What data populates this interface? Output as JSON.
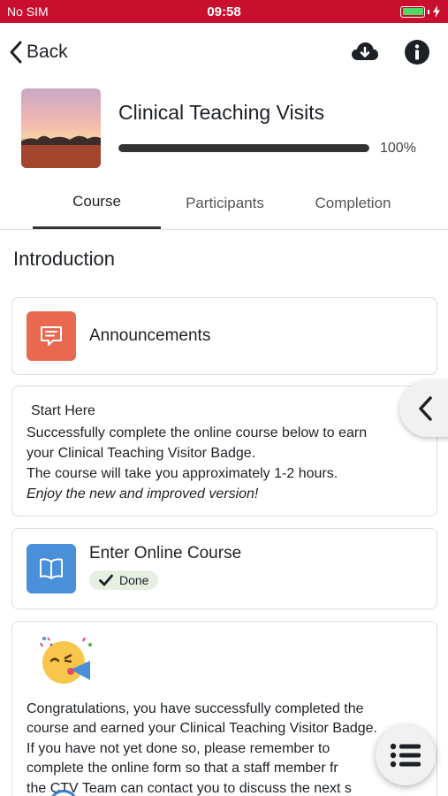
{
  "status_bar": {
    "carrier": "No SIM",
    "time": "09:58"
  },
  "topbar": {
    "back_label": "Back"
  },
  "course": {
    "title": "Clinical Teaching Visits",
    "progress_text": "100%",
    "progress_fraction": 1.0
  },
  "tabs": [
    {
      "label": "Course",
      "active": true
    },
    {
      "label": "Participants",
      "active": false
    },
    {
      "label": "Completion",
      "active": false
    }
  ],
  "section": {
    "title": "Introduction"
  },
  "announcements": {
    "label": "Announcements",
    "color": "#e8694f"
  },
  "start_here": {
    "heading": "Start Here",
    "line1": "Successfully complete the online course below to earn",
    "line2": "your Clinical Teaching Visitor Badge.",
    "line3": "The course will take you approximately 1-2 hours.",
    "line4": "Enjoy the new and improved version!"
  },
  "online_course": {
    "title": "Enter Online Course",
    "status": "Done",
    "color": "#4a90d9"
  },
  "congrats": {
    "line1": "Congratulations, you have successfully completed the",
    "line2": "course and earned your Clinical Teaching Visitor Badge.",
    "line3": "If you have not yet done so, please remember to",
    "line4": "complete the online form so that a staff member fr",
    "line5": "the CTV Team can contact you to discuss the next s"
  },
  "colors": {
    "status_bar": "#c8102e",
    "battery": "#4cd964"
  }
}
